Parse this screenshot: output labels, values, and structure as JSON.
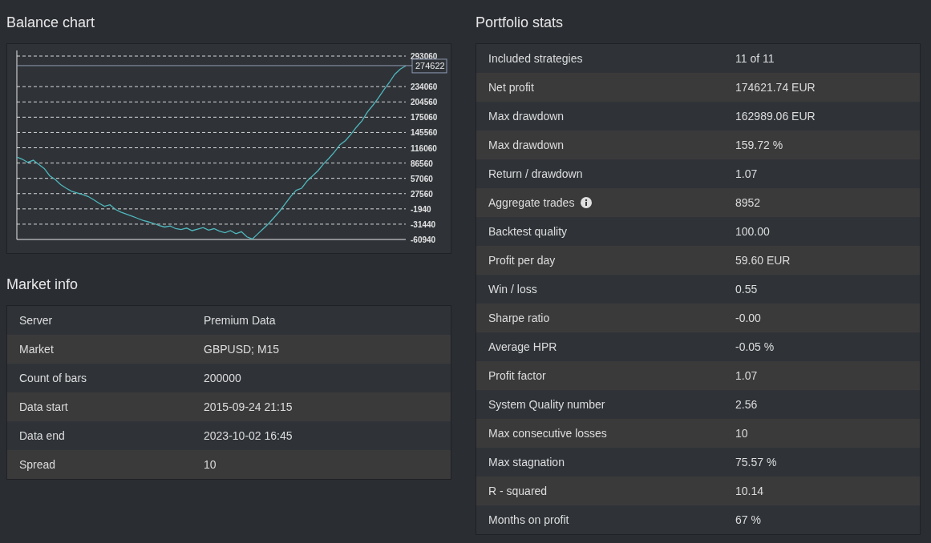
{
  "balance_chart": {
    "title": "Balance chart",
    "chart_data": {
      "type": "line",
      "ylim": [
        -60940,
        293060
      ],
      "yticks": [
        -60940,
        -31440,
        -1940,
        27560,
        57060,
        86560,
        116060,
        145560,
        175060,
        204560,
        234060,
        293060
      ],
      "grid": true,
      "series": [
        {
          "color": "#4fb8bd",
          "values": [
            98000,
            94000,
            88000,
            92000,
            84000,
            76000,
            62000,
            55000,
            45000,
            38000,
            32000,
            29000,
            26000,
            22000,
            16000,
            9000,
            3000,
            6000,
            -3000,
            -8000,
            -12000,
            -16000,
            -20000,
            -24000,
            -27000,
            -30000,
            -34000,
            -37000,
            -35000,
            -40000,
            -42000,
            -39000,
            -44000,
            -41000,
            -38000,
            -43000,
            -40000,
            -45000,
            -48000,
            -44000,
            -50000,
            -46000,
            -56000,
            -60000,
            -50000,
            -40000,
            -30000,
            -18000,
            -6000,
            8000,
            22000,
            34000,
            38000,
            52000,
            62000,
            72000,
            85000,
            96000,
            108000,
            122000,
            130000,
            142000,
            156000,
            168000,
            185000,
            198000,
            212000,
            228000,
            242000,
            258000,
            268000,
            274000
          ]
        }
      ],
      "ref_lines": [
        {
          "axis": "y",
          "value": 274622,
          "label": "274622"
        }
      ]
    }
  },
  "market_info": {
    "title": "Market info",
    "rows": [
      {
        "label": "Server",
        "value": "Premium Data"
      },
      {
        "label": "Market",
        "value": "GBPUSD; M15"
      },
      {
        "label": "Count of bars",
        "value": "200000"
      },
      {
        "label": "Data start",
        "value": "2015-09-24 21:15"
      },
      {
        "label": "Data end",
        "value": "2023-10-02 16:45"
      },
      {
        "label": "Spread",
        "value": "10"
      }
    ]
  },
  "portfolio_stats": {
    "title": "Portfolio stats",
    "rows": [
      {
        "label": "Included strategies",
        "value": "11 of 11"
      },
      {
        "label": "Net profit",
        "value": "174621.74 EUR"
      },
      {
        "label": "Max drawdown",
        "value": "162989.06 EUR"
      },
      {
        "label": "Max drawdown",
        "value": "159.72 %"
      },
      {
        "label": "Return / drawdown",
        "value": "1.07"
      },
      {
        "label": "Aggregate trades",
        "value": "8952",
        "info_icon": true
      },
      {
        "label": "Backtest quality",
        "value": "100.00"
      },
      {
        "label": "Profit per day",
        "value": "59.60 EUR"
      },
      {
        "label": "Win / loss",
        "value": "0.55"
      },
      {
        "label": "Sharpe ratio",
        "value": "-0.00"
      },
      {
        "label": "Average HPR",
        "value": "-0.05 %"
      },
      {
        "label": "Profit factor",
        "value": "1.07"
      },
      {
        "label": "System Quality number",
        "value": "2.56"
      },
      {
        "label": "Max consecutive losses",
        "value": "10"
      },
      {
        "label": "Max stagnation",
        "value": "75.57 %"
      },
      {
        "label": "R - squared",
        "value": "10.14"
      },
      {
        "label": "Months on profit",
        "value": "67 %"
      }
    ]
  }
}
